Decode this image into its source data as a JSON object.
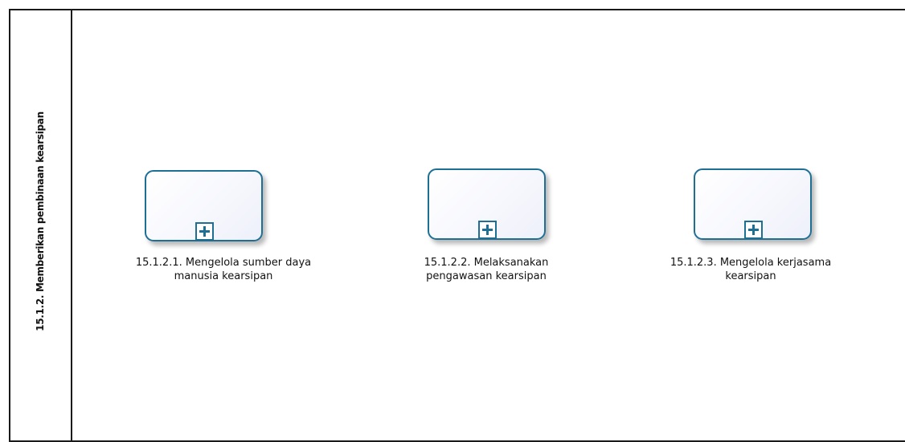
{
  "lane": {
    "title": "15.1.2. Memberikan pembinaan kearsipan"
  },
  "tasks": [
    {
      "label_line1": "15.1.2.1. Mengelola sumber daya",
      "label_line2": "manusia kearsipan",
      "marker": "subprocess-plus-icon"
    },
    {
      "label_line1": "15.1.2.2. Melaksanakan",
      "label_line2": "pengawasan kearsipan",
      "marker": "subprocess-plus-icon"
    },
    {
      "label_line1": "15.1.2.3. Mengelola kerjasama",
      "label_line2": "kearsipan",
      "marker": "subprocess-plus-icon"
    }
  ],
  "colors": {
    "task_border": "#1e6f93",
    "line": "#1a1a1a"
  }
}
